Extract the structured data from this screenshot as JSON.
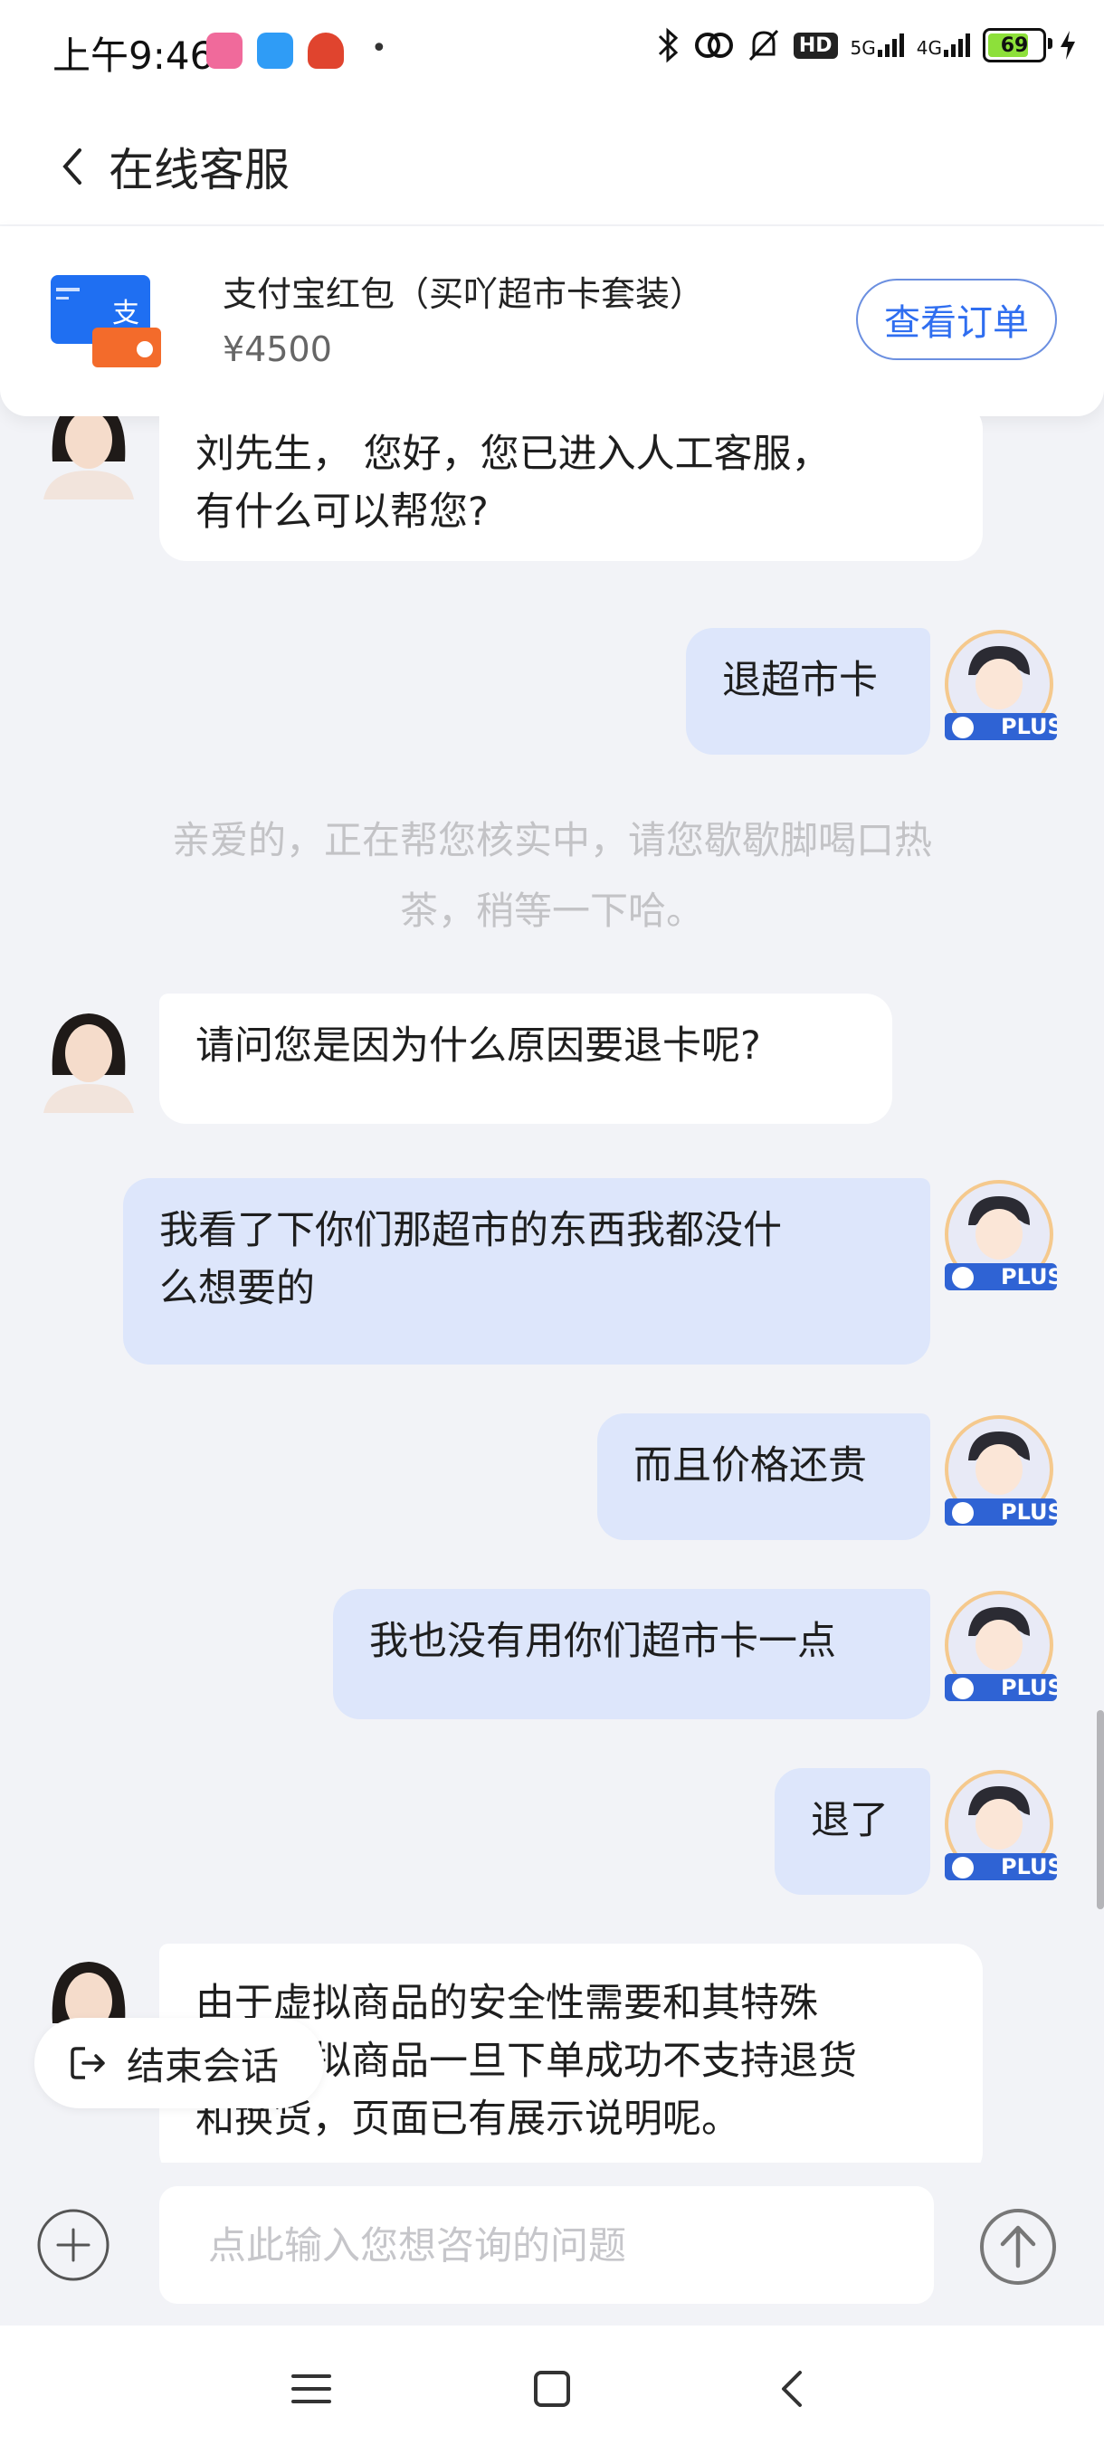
{
  "status_bar": {
    "time": "上午9:46",
    "network_5g": "5G",
    "network_4g": "4G",
    "hd_badge": "HD",
    "battery": "69",
    "icons": [
      "bilibili-icon",
      "chat-bubble-icon",
      "red-app-icon",
      "bluetooth-icon",
      "hotspot-icon",
      "bell-off-icon",
      "charging-icon"
    ]
  },
  "header": {
    "title": "在线客服"
  },
  "product": {
    "name": "支付宝红包（买吖超市卡套装）",
    "price": "¥4500",
    "order_button": "查看订单"
  },
  "messages": [
    {
      "role": "agent",
      "text_1": "刘先生， 您好，您已进入人工客服，",
      "text_2": "有什么可以帮您?"
    },
    {
      "role": "user",
      "text": "退超市卡"
    },
    {
      "role": "system",
      "text_1": "亲爱的，正在帮您核实中，请您歇歇脚喝口热",
      "text_2": "茶，稍等一下哈。"
    },
    {
      "role": "agent",
      "text": "请问您是因为什么原因要退卡呢?"
    },
    {
      "role": "user",
      "text_1": "我看了下你们那超市的东西我都没什",
      "text_2": "么想要的"
    },
    {
      "role": "user",
      "text": "而且价格还贵"
    },
    {
      "role": "user",
      "text": "我也没有用你们超市卡一点"
    },
    {
      "role": "user",
      "text": "退了"
    },
    {
      "role": "agent",
      "text_1": "由于虚拟商品的安全性需要和其特殊",
      "text_2": "性，虚拟商品一旦下单成功不支持退货",
      "text_3": "和换货，页面已有展示说明呢。"
    }
  ],
  "user_badge": "PLUS",
  "end_session": {
    "label": "结束会话"
  },
  "input": {
    "placeholder": "点此输入您想咨询的问题"
  },
  "colors": {
    "accent": "#2f6ef0",
    "user_bubble": "#dde6fb",
    "background": "#f2f3f7"
  }
}
